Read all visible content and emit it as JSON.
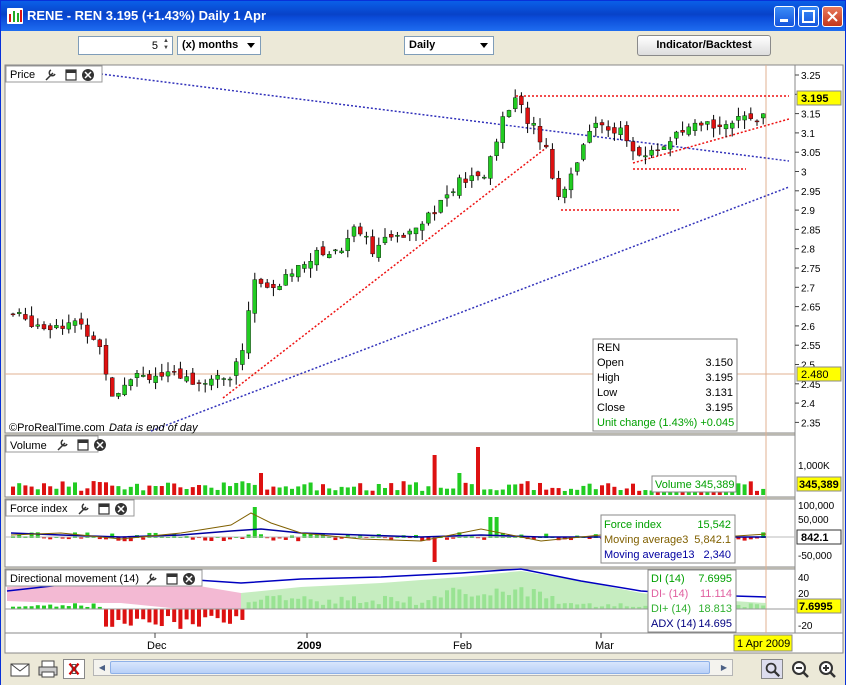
{
  "window": {
    "title": "RENE - REN   3.195 (+1.43%)   Daily  1 Apr"
  },
  "toolbar": {
    "period_value": "5",
    "period_unit": "(x) months",
    "interval": "Daily",
    "indicator_button": "Indicator/Backtest"
  },
  "panels": {
    "price": {
      "label": "Price",
      "current_label": "3.195",
      "crosshair_label": "2.480",
      "credit": "©ProRealTime.com",
      "note": "Data is end of day",
      "yticks": [
        "3.25",
        "3.2",
        "3.15",
        "3.1",
        "3.05",
        "3",
        "2.95",
        "2.9",
        "2.85",
        "2.8",
        "2.75",
        "2.7",
        "2.65",
        "2.6",
        "2.55",
        "2.5",
        "2.45",
        "2.4",
        "2.35"
      ]
    },
    "volume": {
      "label": "Volume",
      "readout": "Volume 345,389",
      "current_label": "345,389",
      "ytick": "1,000K"
    },
    "force": {
      "label": "Force index",
      "current_label": "842.1",
      "yticks": [
        "100,000",
        "50,000",
        "0",
        "-50,000"
      ]
    },
    "dm": {
      "label": "Directional movement (14)",
      "current_label": "7.6995",
      "yticks": [
        "40",
        "20",
        "0",
        "-20"
      ]
    }
  },
  "ohlc_box": {
    "symbol": "REN",
    "rows": [
      {
        "label": "Open",
        "value": "3.150"
      },
      {
        "label": "High",
        "value": "3.195"
      },
      {
        "label": "Low",
        "value": "3.131"
      },
      {
        "label": "Close",
        "value": "3.195"
      }
    ],
    "change": "Unit change (1.43%) +0.045"
  },
  "force_box": [
    {
      "label": "Force index",
      "value": "15,542",
      "color": "#00a000"
    },
    {
      "label": "Moving average3",
      "value": "5,842.1",
      "color": "#806000"
    },
    {
      "label": "Moving average13",
      "value": "2,340",
      "color": "#0000a0"
    }
  ],
  "dm_box": [
    {
      "label": "DI (14)",
      "value": "7.6995",
      "color": "#00a000"
    },
    {
      "label": "DI- (14)",
      "value": "11.114",
      "color": "#e060a0"
    },
    {
      "label": "DI+ (14)",
      "value": "18.813",
      "color": "#30b030"
    },
    {
      "label": "ADX (14)",
      "value": "14.695",
      "color": "#000080"
    }
  ],
  "xaxis": {
    "labels": [
      "Dec",
      "2009",
      "Feb",
      "Mar"
    ],
    "date_label": "1 Apr 2009"
  },
  "colors": {
    "up": "#22cc22",
    "down": "#dd1111",
    "trend_red": "#ee1111",
    "trend_blue": "#3333bb",
    "axis_highlight": "#ffff00",
    "title_blue": "#0842c8"
  },
  "icons": [
    "wrench-icon",
    "window-icon",
    "close-icon",
    "mail-icon",
    "print-icon",
    "disconnect-icon",
    "zoom-fit-icon",
    "zoom-out-icon",
    "zoom-in-icon"
  ]
}
